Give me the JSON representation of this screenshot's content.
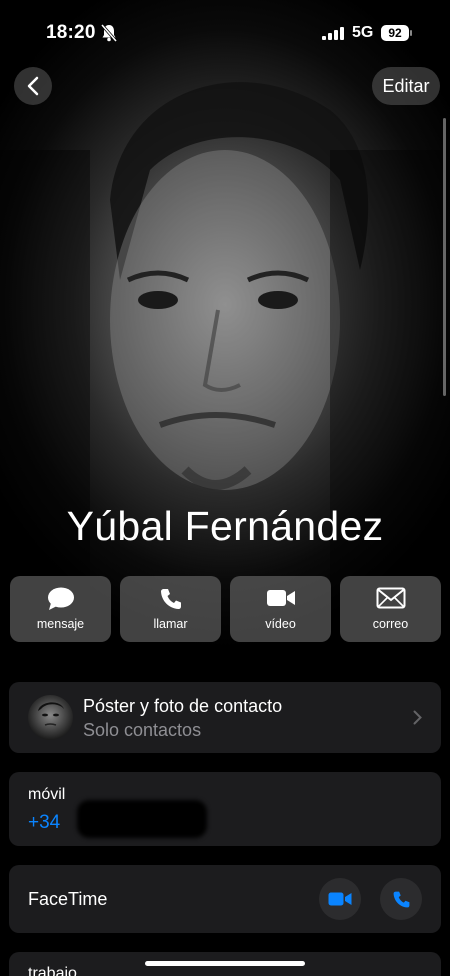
{
  "status_bar": {
    "time": "18:20",
    "network": "5G",
    "battery": "92",
    "icons": [
      "bell-slash-icon",
      "signal-icon",
      "battery-icon"
    ]
  },
  "header": {
    "back_icon": "chevron-left-icon",
    "edit_label": "Editar"
  },
  "contact": {
    "name": "Yúbal Fernández"
  },
  "actions": [
    {
      "label": "mensaje",
      "icon": "message-bubble-icon"
    },
    {
      "label": "llamar",
      "icon": "phone-icon"
    },
    {
      "label": "vídeo",
      "icon": "video-camera-icon"
    },
    {
      "label": "correo",
      "icon": "envelope-icon"
    }
  ],
  "poster_card": {
    "title": "Póster y foto de contacto",
    "subtitle": "Solo contactos"
  },
  "phone": {
    "label": "móvil",
    "value": "+34 "
  },
  "facetime": {
    "label": "FaceTime"
  },
  "work": {
    "label": "trabajo"
  },
  "colors": {
    "accent": "#0a84ff",
    "card_bg": "#1c1c1e",
    "secondary_text": "#8e8e93"
  }
}
